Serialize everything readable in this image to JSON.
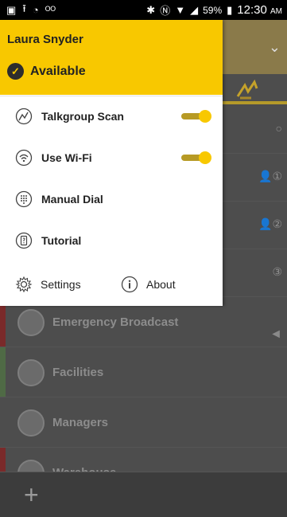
{
  "status_bar": {
    "battery_percent": "59%",
    "time": "12:30",
    "ampm": "AM"
  },
  "drawer": {
    "user_name": "Laura Snyder",
    "status": "Available",
    "items": [
      {
        "label": "Talkgroup Scan",
        "toggle": true
      },
      {
        "label": "Use Wi-Fi",
        "toggle": true
      },
      {
        "label": "Manual Dial"
      },
      {
        "label": "Tutorial"
      }
    ],
    "footer": {
      "settings": "Settings",
      "about": "About"
    }
  },
  "background_list": {
    "rows": [
      {
        "label": "Emergency Broadcast",
        "stripe_color": "#7a2a2a"
      },
      {
        "label": "Facilities",
        "stripe_color": "#4f6a45"
      },
      {
        "label": "Managers",
        "stripe_color": ""
      },
      {
        "label": "Warehouse",
        "stripe_color": "#7a2a2a"
      }
    ]
  },
  "colors": {
    "accent_yellow": "#f8c800",
    "toggle_track": "#b79a25"
  }
}
